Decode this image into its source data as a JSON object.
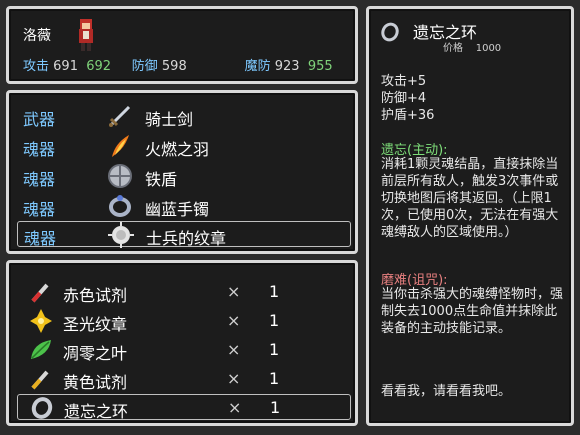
{
  "hero": {
    "name": "洛薇",
    "stats": [
      {
        "label": "攻击",
        "value": "691",
        "bonus": "692"
      },
      {
        "label": "防御",
        "value": "598",
        "bonus": ""
      },
      {
        "label": "魔防",
        "value": "923",
        "bonus": "955"
      }
    ]
  },
  "equipment": [
    {
      "slot": "武器",
      "name": "骑士剑",
      "icon": "sword-icon"
    },
    {
      "slot": "魂器",
      "name": "火燃之羽",
      "icon": "flame-feather-icon"
    },
    {
      "slot": "魂器",
      "name": "铁盾",
      "icon": "round-shield-icon"
    },
    {
      "slot": "魂器",
      "name": "幽蓝手镯",
      "icon": "bracelet-icon"
    },
    {
      "slot": "魂器",
      "name": "士兵的纹章",
      "icon": "emblem-icon"
    }
  ],
  "inventory": [
    {
      "name": "赤色试剂",
      "x": "×",
      "qty": "1",
      "icon": "red-potion-icon"
    },
    {
      "name": "圣光纹章",
      "x": "×",
      "qty": "1",
      "icon": "holy-emblem-icon"
    },
    {
      "name": "凋零之叶",
      "x": "×",
      "qty": "1",
      "icon": "leaf-icon"
    },
    {
      "name": "黄色试剂",
      "x": "×",
      "qty": "1",
      "icon": "yellow-potion-icon"
    },
    {
      "name": "遗忘之环",
      "x": "×",
      "qty": "1",
      "icon": "ring-icon"
    }
  ],
  "detail": {
    "title": "遗忘之环",
    "price_label": "价格",
    "price": "1000",
    "stats": [
      "攻击+5",
      "防御+4",
      "护盾+36"
    ],
    "active_head": "遗忘(主动):",
    "active_text": "消耗1颗灵魂结晶，直接抹除当前层所有敌人，触发3次事件或切换地图后将其返回。（上限1次，已使用0次，无法在有强大魂缚敌人的区域使用。）",
    "curse_head": "磨难(诅咒):",
    "curse_text": "当你击杀强大的魂缚怪物时，强制失去1000点生命值并抹除此装备的主动技能记录。",
    "flavor": "看看我，请看看我吧。"
  }
}
